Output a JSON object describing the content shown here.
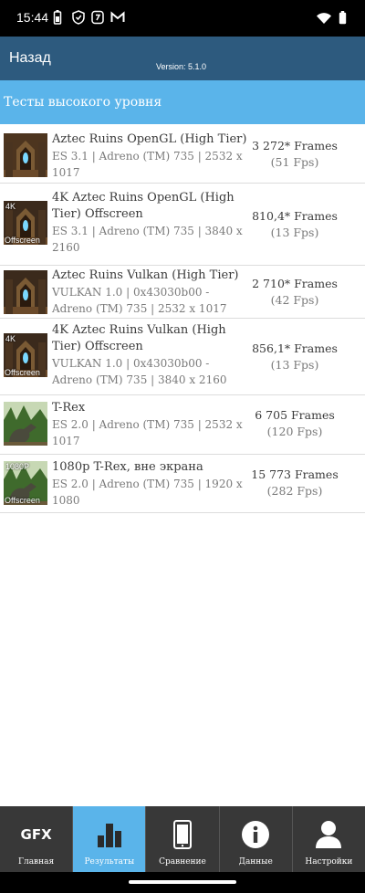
{
  "status_bar": {
    "time": "15:44",
    "icons": [
      "battery-saver-icon",
      "shield-icon",
      "app-icon",
      "gmail-icon"
    ],
    "right_icons": [
      "wifi-icon",
      "battery-icon"
    ]
  },
  "app_bar": {
    "back_label": "Назад",
    "version": "Version: 5.1.0"
  },
  "section": {
    "title": "Тесты высокого уровня"
  },
  "tests": [
    {
      "thumb": "aztec",
      "badge_top": "",
      "badge_bottom": "",
      "title": "Aztec Ruins OpenGL (High Tier)",
      "details": "ES 3.1 | Adreno (TM) 735 | 2532 x 1017",
      "frames": "3 272* Frames",
      "fps": "(51 Fps)"
    },
    {
      "thumb": "aztec",
      "badge_top": "4K",
      "badge_bottom": "Offscreen",
      "title": "4K Aztec Ruins OpenGL (High Tier) Offscreen",
      "details": "ES 3.1 | Adreno (TM) 735 | 3840 x 2160",
      "frames": "810,4* Frames",
      "fps": "(13 Fps)"
    },
    {
      "thumb": "aztec",
      "badge_top": "",
      "badge_bottom": "",
      "title": "Aztec Ruins Vulkan (High Tier)",
      "details": "VULKAN 1.0 | 0x43030b00 - Adreno (TM) 735 | 2532 x 1017",
      "frames": "2 710* Frames",
      "fps": "(42 Fps)"
    },
    {
      "thumb": "aztec",
      "badge_top": "4K",
      "badge_bottom": "Offscreen",
      "title": "4K Aztec Ruins Vulkan (High Tier) Offscreen",
      "details": "VULKAN 1.0 | 0x43030b00 - Adreno (TM) 735 | 3840 x 2160",
      "frames": "856,1* Frames",
      "fps": "(13 Fps)"
    },
    {
      "thumb": "trex",
      "badge_top": "",
      "badge_bottom": "",
      "title": "T-Rex",
      "details": "ES 2.0 | Adreno (TM) 735 | 2532 x 1017",
      "frames": "6 705 Frames",
      "fps": "(120 Fps)"
    },
    {
      "thumb": "trex",
      "badge_top": "1080P",
      "badge_bottom": "Offscreen",
      "title": "1080p T-Rex, вне экрана",
      "details": "ES 2.0 | Adreno (TM) 735 | 1920 x 1080",
      "frames": "15 773 Frames",
      "fps": "(282 Fps)"
    }
  ],
  "bottom_nav": [
    {
      "icon": "gfx-logo-icon",
      "icon_text": "GFX",
      "label": "Главная",
      "active": false
    },
    {
      "icon": "bar-chart-icon",
      "icon_text": "",
      "label": "Результаты",
      "active": true
    },
    {
      "icon": "phone-icon",
      "icon_text": "",
      "label": "Сравнение",
      "active": false
    },
    {
      "icon": "info-icon",
      "icon_text": "",
      "label": "Данные",
      "active": false
    },
    {
      "icon": "user-icon",
      "icon_text": "",
      "label": "Настройки",
      "active": false
    }
  ],
  "colors": {
    "app_bar": "#2d5a7e",
    "section": "#5ab4ea",
    "nav_active": "#5ab4ea",
    "nav_bg": "#383838"
  }
}
